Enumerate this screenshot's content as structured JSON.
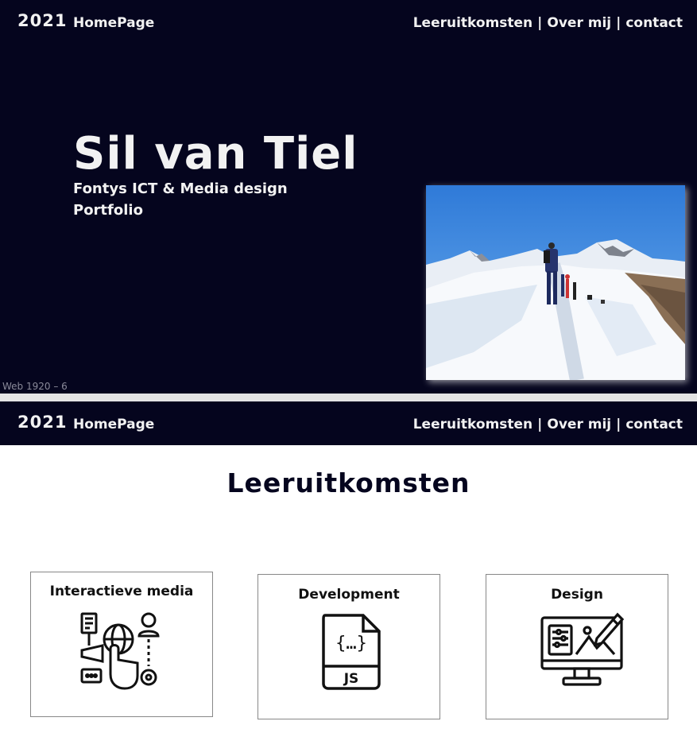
{
  "nav": {
    "year": "2021",
    "home": "HomePage",
    "links": [
      "Leeruitkomsten",
      "Over mij",
      "contact"
    ],
    "separator": "|"
  },
  "hero": {
    "name": "Sil van Tiel",
    "subtitle_line1": "Fontys ICT & Media design",
    "subtitle_line2": "Portfolio",
    "photo_icon": "mountain-hikers-photo"
  },
  "artboard_label": "Web 1920 – 6",
  "section": {
    "title": "Leeruitkomsten",
    "cards": [
      {
        "title": "Interactieve media",
        "icon": "interactive-media-icon"
      },
      {
        "title": "Development",
        "icon": "js-file-icon"
      },
      {
        "title": "Design",
        "icon": "design-monitor-icon"
      }
    ]
  },
  "colors": {
    "background_dark": "#05051e",
    "text_light": "#f2f2f2",
    "page_background": "#ffffff"
  }
}
